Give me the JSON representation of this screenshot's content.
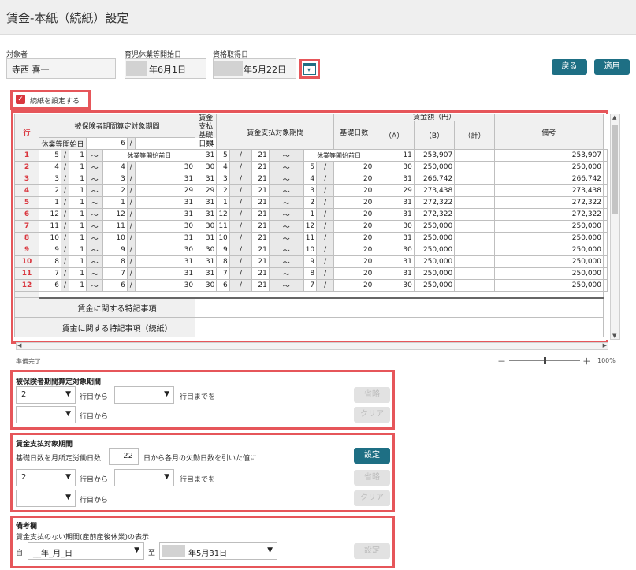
{
  "title": "賃金-本紙（続紙）設定",
  "subject": {
    "label": "対象者",
    "value": "寺西 喜一"
  },
  "leave_start": {
    "label": "育児休業等開始日",
    "value": "年6月1日"
  },
  "qualify_date": {
    "label": "資格取得日",
    "value": "年5月22日"
  },
  "buttons": {
    "back": "戻る",
    "apply": "適用"
  },
  "continuation": {
    "label": "続紙を設定する",
    "checked": true
  },
  "grid": {
    "h_row": "行",
    "h_period": "被保険者期間算定対象期間",
    "h_leave_start": "休業等開始日",
    "leave_month": "6",
    "leave_day": "1",
    "h_pay_days_1": "賃金支払",
    "h_pay_days_2": "基礎日数",
    "h_pay_period": "賃金支払対象期間",
    "h_base_days": "基礎日数",
    "h_wage": "賃金額（円）",
    "h_a": "（A）",
    "h_b": "（B）",
    "h_total": "（計）",
    "h_remarks": "備考",
    "leave_prev_label": "休業等開始前日",
    "slash": "/",
    "tilde": "〜",
    "rows": [
      {
        "no": "1",
        "fm": "5",
        "fd": "1",
        "tm": "休業等開始前日",
        "td": "",
        "days": "31",
        "pm": "5",
        "pd": "21",
        "qm": "休業等開始前日",
        "qd": "",
        "base": "11",
        "a": "253,907",
        "b": "",
        "total": "253,907"
      },
      {
        "no": "2",
        "fm": "4",
        "fd": "1",
        "tm": "4",
        "td": "30",
        "days": "30",
        "pm": "4",
        "pd": "21",
        "qm": "5",
        "qd": "20",
        "base": "30",
        "a": "250,000",
        "b": "",
        "total": "250,000"
      },
      {
        "no": "3",
        "fm": "3",
        "fd": "1",
        "tm": "3",
        "td": "31",
        "days": "31",
        "pm": "3",
        "pd": "21",
        "qm": "4",
        "qd": "20",
        "base": "31",
        "a": "266,742",
        "b": "",
        "total": "266,742"
      },
      {
        "no": "4",
        "fm": "2",
        "fd": "1",
        "tm": "2",
        "td": "29",
        "days": "29",
        "pm": "2",
        "pd": "21",
        "qm": "3",
        "qd": "20",
        "base": "29",
        "a": "273,438",
        "b": "",
        "total": "273,438"
      },
      {
        "no": "5",
        "fm": "1",
        "fd": "1",
        "tm": "1",
        "td": "31",
        "days": "31",
        "pm": "1",
        "pd": "21",
        "qm": "2",
        "qd": "20",
        "base": "31",
        "a": "272,322",
        "b": "",
        "total": "272,322"
      },
      {
        "no": "6",
        "fm": "12",
        "fd": "1",
        "tm": "12",
        "td": "31",
        "days": "31",
        "pm": "12",
        "pd": "21",
        "qm": "1",
        "qd": "20",
        "base": "31",
        "a": "272,322",
        "b": "",
        "total": "272,322"
      },
      {
        "no": "7",
        "fm": "11",
        "fd": "1",
        "tm": "11",
        "td": "30",
        "days": "30",
        "pm": "11",
        "pd": "21",
        "qm": "12",
        "qd": "20",
        "base": "30",
        "a": "250,000",
        "b": "",
        "total": "250,000"
      },
      {
        "no": "8",
        "fm": "10",
        "fd": "1",
        "tm": "10",
        "td": "31",
        "days": "31",
        "pm": "10",
        "pd": "21",
        "qm": "11",
        "qd": "20",
        "base": "31",
        "a": "250,000",
        "b": "",
        "total": "250,000"
      },
      {
        "no": "9",
        "fm": "9",
        "fd": "1",
        "tm": "9",
        "td": "30",
        "days": "30",
        "pm": "9",
        "pd": "21",
        "qm": "10",
        "qd": "20",
        "base": "30",
        "a": "250,000",
        "b": "",
        "total": "250,000"
      },
      {
        "no": "10",
        "fm": "8",
        "fd": "1",
        "tm": "8",
        "td": "31",
        "days": "31",
        "pm": "8",
        "pd": "21",
        "qm": "9",
        "qd": "20",
        "base": "31",
        "a": "250,000",
        "b": "",
        "total": "250,000"
      },
      {
        "no": "11",
        "fm": "7",
        "fd": "1",
        "tm": "7",
        "td": "31",
        "days": "31",
        "pm": "7",
        "pd": "21",
        "qm": "8",
        "qd": "20",
        "base": "31",
        "a": "250,000",
        "b": "",
        "total": "250,000"
      },
      {
        "no": "12",
        "fm": "6",
        "fd": "1",
        "tm": "6",
        "td": "30",
        "days": "30",
        "pm": "6",
        "pd": "21",
        "qm": "7",
        "qd": "20",
        "base": "30",
        "a": "250,000",
        "b": "",
        "total": "250,000"
      }
    ],
    "special_1": "賃金に関する特記事項",
    "special_2": "賃金に関する特記事項（続紙）"
  },
  "status": {
    "text": "準備完了",
    "zoom": "100%",
    "zoom_level": 0.5,
    "minus": "－",
    "plus": "＋"
  },
  "period_section": {
    "title": "被保険者期間算定対象期間",
    "from_value": "2",
    "from_suffix": "行目から",
    "to_value": "",
    "to_suffix": "行目までを",
    "row2_value": "",
    "row2_suffix": "行目から",
    "omit": "省略",
    "clear": "クリア"
  },
  "wage_section": {
    "title": "賃金支払対象期間",
    "desc_prefix": "基礎日数を月所定労働日数",
    "days_value": "22",
    "desc_suffix": "日から各月の欠勤日数を引いた値に",
    "set": "設定",
    "from_value": "2",
    "from_suffix": "行目から",
    "to_value": "",
    "to_suffix": "行目までを",
    "row2_value": "",
    "row2_suffix": "行目から",
    "omit": "省略",
    "clear": "クリア"
  },
  "remarks_section": {
    "title": "備考欄",
    "desc": "賃金支払のない期間(産前産後休業)の表示",
    "from_label": "自",
    "from_value": "__年_月_日",
    "to_label": "至",
    "to_value": "年5月31日",
    "set": "設定"
  },
  "colors": {
    "accent": "#1e6f84",
    "highlight": "#e6565a",
    "row_number": "#d9363e"
  }
}
